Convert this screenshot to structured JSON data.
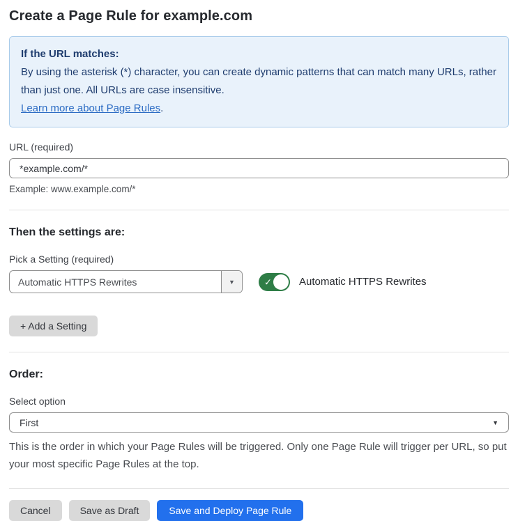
{
  "page": {
    "title": "Create a Page Rule for example.com"
  },
  "info_box": {
    "heading": "If the URL matches:",
    "body": "By using the asterisk (*) character, you can create dynamic patterns that can match many URLs, rather than just one. All URLs are case insensitive.",
    "link_label": "Learn more about Page Rules",
    "link_suffix": "."
  },
  "url_field": {
    "label": "URL (required)",
    "value": "*example.com/*",
    "helper": "Example: www.example.com/*"
  },
  "settings_section": {
    "heading": "Then the settings are:",
    "picker_label": "Pick a Setting (required)",
    "picker_value": "Automatic HTTPS Rewrites",
    "toggle_state": "on",
    "toggle_label": "Automatic HTTPS Rewrites",
    "add_setting_label": "+ Add a Setting"
  },
  "order_section": {
    "heading": "Order:",
    "select_label": "Select option",
    "select_value": "First",
    "helper": "This is the order in which your Page Rules will be triggered. Only one Page Rule will trigger per URL, so put your most specific Page Rules at the top."
  },
  "footer": {
    "cancel_label": "Cancel",
    "save_draft_label": "Save as Draft",
    "save_deploy_label": "Save and Deploy Page Rule"
  },
  "icons": {
    "check": "✓",
    "caret_down": "▼"
  },
  "colors": {
    "info_bg": "#e9f2fb",
    "info_border": "#a9cbea",
    "info_text": "#1e3c6e",
    "link_blue": "#2c6cc4",
    "toggle_green": "#2e7d46",
    "primary_blue": "#2270ed",
    "button_gray": "#d9d9d9"
  }
}
